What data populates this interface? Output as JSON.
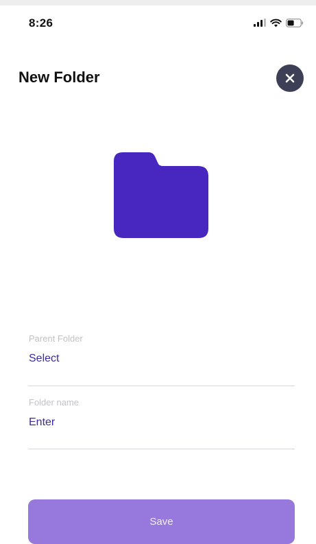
{
  "status_bar": {
    "time": "8:26",
    "icons": [
      "signal-icon",
      "wifi-icon",
      "battery-icon"
    ]
  },
  "header": {
    "title": "New Folder",
    "close_icon": "close-icon"
  },
  "illustration": {
    "icon": "folder-icon",
    "color": "#4727bf"
  },
  "form": {
    "parent_folder": {
      "label": "Parent Folder",
      "value": "Select"
    },
    "folder_name": {
      "label": "Folder name",
      "value": "Enter"
    }
  },
  "actions": {
    "save_label": "Save"
  },
  "colors": {
    "accent": "#4727bf",
    "link_text": "#3a2a9e",
    "save_button": "#9778dc",
    "close_button": "#3c3f56"
  }
}
